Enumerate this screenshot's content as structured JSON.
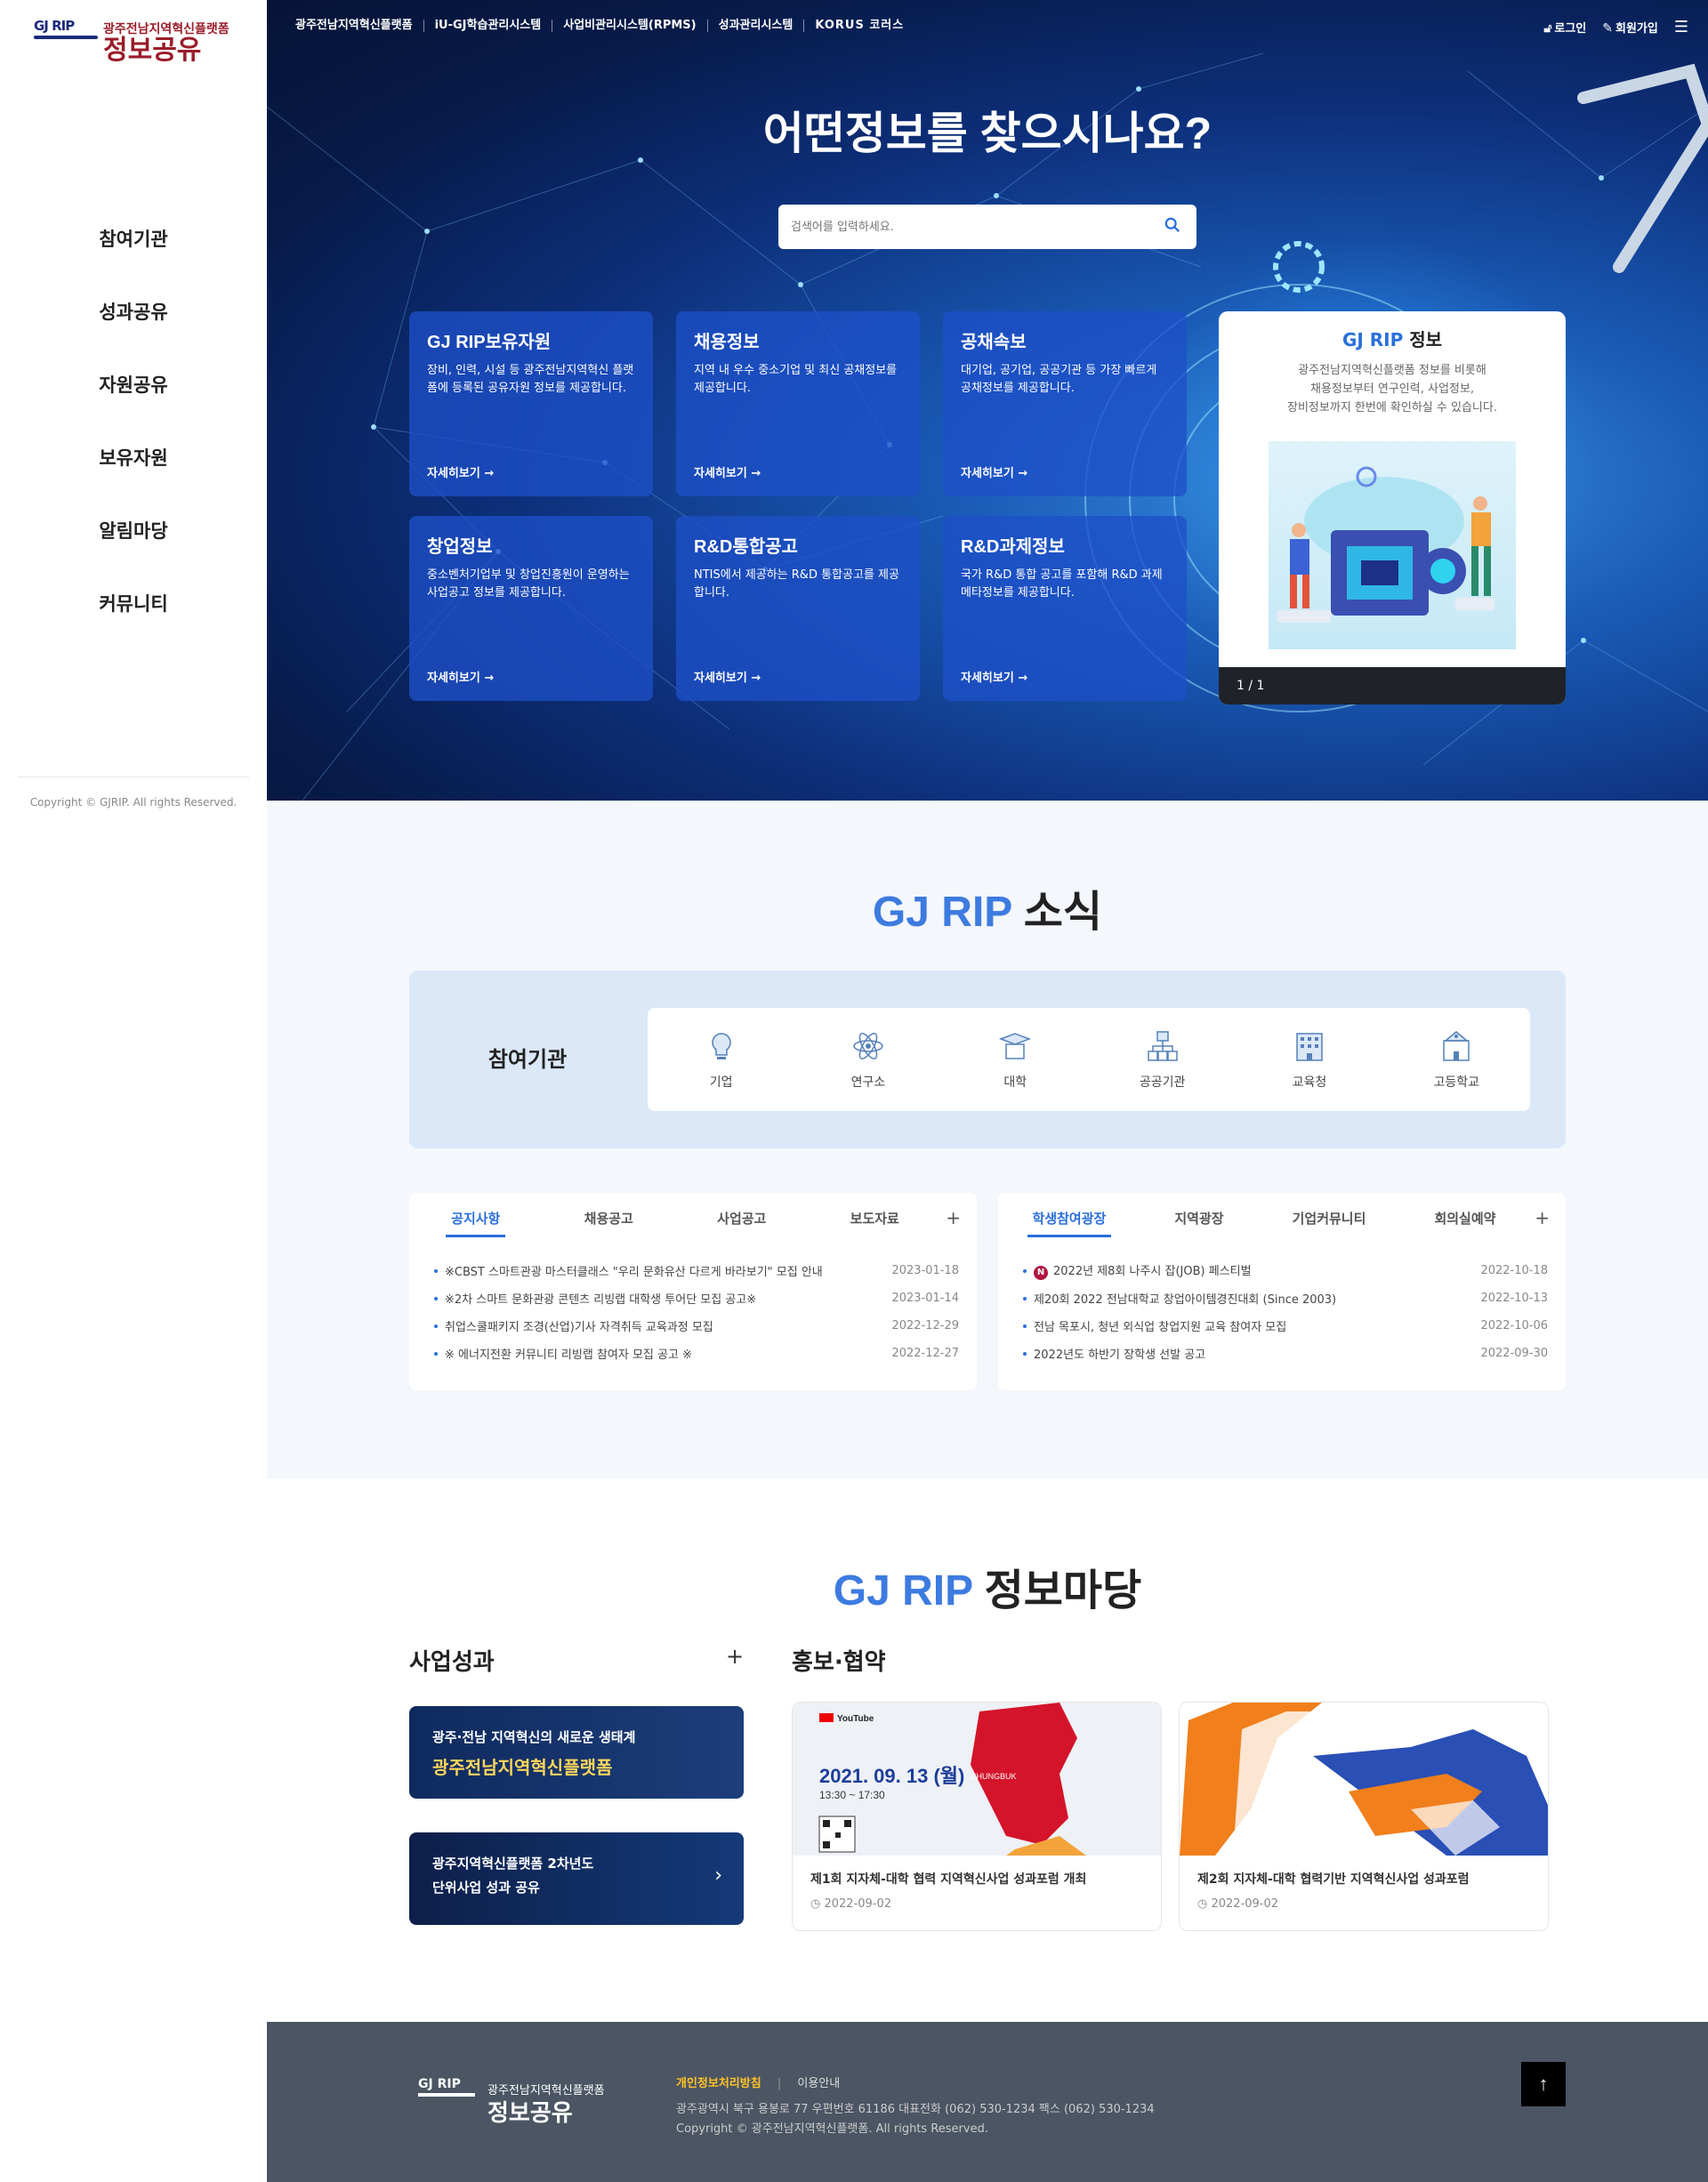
{
  "sidebar": {
    "logo_mark": "GJ RIP",
    "logo_sub": "광주전남지역혁신플랫폼",
    "logo_main": "정보공유",
    "nav": [
      "참여기관",
      "성과공유",
      "자원공유",
      "보유자원",
      "알림마당",
      "커뮤니티"
    ],
    "copyright": "Copyright © GJRIP. All rights Reserved."
  },
  "topnav": {
    "links": [
      "광주전남지역혁신플랫폼",
      "iU-GJ학습관리시스템",
      "사업비관리시스템(RPMS)",
      "성과관리시스템",
      "KORUS 코러스"
    ],
    "login": "로그인",
    "signup": "회원가입"
  },
  "hero": {
    "title": "어떤정보를 찾으시나요?",
    "search_placeholder": "검색어를 입력하세요.",
    "cards": [
      {
        "title": "GJ RIP보유자원",
        "desc": "장비, 인력, 시설 등 광주전남지역혁신 플랫폼에 등록된 공유자원 정보를 제공합니다.",
        "more": "자세히보기 →"
      },
      {
        "title": "채용정보",
        "desc": "지역 내 우수 중소기업 및 최신 공채정보를 제공합니다.",
        "more": "자세히보기 →"
      },
      {
        "title": "공채속보",
        "desc": "대기업, 공기업, 공공기관 등 가장 빠르게 공채정보를 제공합니다.",
        "more": "자세히보기 →"
      },
      {
        "title": "창업정보",
        "desc": "중소벤처기업부 및 창업진흥원이 운영하는 사업공고 정보를 제공합니다.",
        "more": "자세히보기 →"
      },
      {
        "title": "R&D통합공고",
        "desc": "NTIS에서 제공하는 R&D 통합공고를 제공합니다.",
        "more": "자세히보기 →"
      },
      {
        "title": "R&D과제정보",
        "desc": "국가 R&D 통합 공고를 포함해 R&D 과제 메타정보를 제공합니다.",
        "more": "자세히보기 →"
      }
    ],
    "info": {
      "title_blue": "GJ RIP",
      "title_rest": " 정보",
      "desc1": "광주전남지역혁신플랫폼 정보를 비롯해",
      "desc2": "채용정보부터 연구인력, 사업정보,",
      "desc3": "장비정보까지 한번에 확인하실 수 있습니다.",
      "pager": "1 / 1"
    }
  },
  "news": {
    "title_blue": "GJ RIP",
    "title_rest": " 소식",
    "participants_label": "참여기관",
    "participants": [
      {
        "label": "기업",
        "icon": "lightbulb-icon"
      },
      {
        "label": "연구소",
        "icon": "atom-icon"
      },
      {
        "label": "대학",
        "icon": "graduation-cap-icon"
      },
      {
        "label": "공공기관",
        "icon": "org-chart-icon"
      },
      {
        "label": "교육청",
        "icon": "building-icon"
      },
      {
        "label": "고등학교",
        "icon": "school-icon"
      }
    ],
    "board_left": {
      "tabs": [
        "공지사항",
        "채용공고",
        "사업공고",
        "보도자료"
      ],
      "items": [
        {
          "text": "※CBST 스마트관광 마스터클래스 \"우리 문화유산 다르게 바라보기\" 모집 안내",
          "date": "2023-01-18"
        },
        {
          "text": "※2차 스마트 문화관광 콘텐츠 리빙랩 대학생 투어단 모집 공고※",
          "date": "2023-01-14"
        },
        {
          "text": "취업스쿨패키지 조경(산업)기사 자격취득 교육과정 모집",
          "date": "2022-12-29"
        },
        {
          "text": "※ 에너지전환 커뮤니티 리빙랩 참여자 모집 공고 ※",
          "date": "2022-12-27"
        }
      ]
    },
    "board_right": {
      "tabs": [
        "학생참여광장",
        "지역광장",
        "기업커뮤니티",
        "회의실예약"
      ],
      "new_badge": "N",
      "items": [
        {
          "text": "2022년 제8회 나주시 잡(JOB) 페스티벌",
          "date": "2022-10-18"
        },
        {
          "text": "제20회 2022 전남대학교 창업아이템경진대회 (Since 2003)",
          "date": "2022-10-13"
        },
        {
          "text": "전남 목포시, 청년 외식업 창업지원 교육 참여자 모집",
          "date": "2022-10-06"
        },
        {
          "text": "2022년도 하반기 장학생 선발 공고",
          "date": "2022-09-30"
        }
      ]
    }
  },
  "info_yard": {
    "title_blue": "GJ RIP",
    "title_rest": " 정보마당",
    "results_title": "사업성과",
    "promo_title": "홍보·협약",
    "banners": [
      {
        "line1": "광주·전남 지역혁신의 새로운 생태계",
        "line2": "광주전남지역혁신플랫폼"
      },
      {
        "line1": "광주지역혁신플랫폼 2차년도",
        "line2": "단위사업 성과 공유"
      }
    ],
    "promo_cards": [
      {
        "title": "제1회 지자체-대학 협력 지역혁신사업 성과포럼 개최",
        "date": "2022-09-02",
        "poster_date": "2021. 09. 13 (월)",
        "poster_time": "13:30 ~ 17:30",
        "poster_region": "CHUNGBUK",
        "poster_brand": "YouTube"
      },
      {
        "title": "제2회 지자체-대학 협력기반 지역혁신사업 성과포럼",
        "date": "2022-09-02"
      }
    ]
  },
  "footer": {
    "privacy": "개인정보처리방침",
    "terms": "이용안내",
    "address": "광주광역시 북구 용봉로 77 우편번호 61186 대표전화 (062) 530-1234 팩스 (062) 530-1234",
    "copyright": "Copyright © 광주전남지역혁신플랫폼. All rights Reserved.",
    "top": "↑"
  },
  "colors": {
    "accent": "#2a6fdb",
    "brand_red": "#9a1c2a",
    "footer_bg": "#4b5563"
  }
}
